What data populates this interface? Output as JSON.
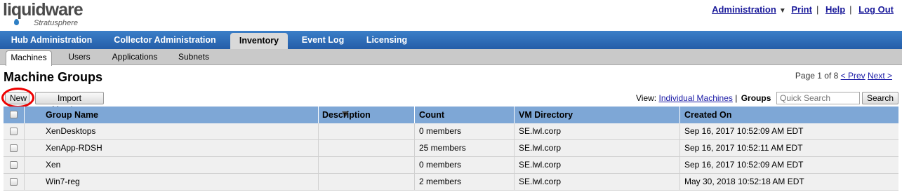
{
  "logo": {
    "brand": "liquidware",
    "sub": "Stratusphere"
  },
  "toplinks": {
    "admin": "Administration",
    "print": "Print",
    "help": "Help",
    "logout": "Log Out"
  },
  "mainnav": [
    "Hub Administration",
    "Collector Administration",
    "Inventory",
    "Event Log",
    "Licensing"
  ],
  "mainnav_active": "Inventory",
  "subnav": [
    "Machines",
    "Users",
    "Applications",
    "Subnets"
  ],
  "subnav_active": "Machines",
  "page_title": "Machine Groups",
  "paging": {
    "text": "Page 1 of 8",
    "prev": "< Prev",
    "next": "Next >"
  },
  "buttons": {
    "new": "New",
    "import": "Import Members",
    "search": "Search"
  },
  "view": {
    "label": "View:",
    "individual": "Individual Machines",
    "sep": "|",
    "groups": "Groups"
  },
  "search": {
    "placeholder": "Quick Search"
  },
  "table": {
    "columns": [
      "Group Name",
      "Description",
      "Count",
      "VM Directory",
      "Created On"
    ],
    "rows": [
      {
        "name": "XenDesktops",
        "description": "",
        "count": "0 members",
        "dir": "SE.lwl.corp",
        "created": "Sep 16, 2017 10:52:09 AM EDT"
      },
      {
        "name": "XenApp-RDSH",
        "description": "",
        "count": "25 members",
        "dir": "SE.lwl.corp",
        "created": "Sep 16, 2017 10:52:11 AM EDT"
      },
      {
        "name": "Xen",
        "description": "",
        "count": "0 members",
        "dir": "SE.lwl.corp",
        "created": "Sep 16, 2017 10:52:09 AM EDT"
      },
      {
        "name": "Win7-reg",
        "description": "",
        "count": "2 members",
        "dir": "SE.lwl.corp",
        "created": "May 30, 2018 10:52:18 AM EDT"
      }
    ]
  },
  "colors": {
    "nav_blue": "#2c6bb8",
    "header_blue": "#7ea7d6",
    "highlight_red": "#e00000"
  }
}
